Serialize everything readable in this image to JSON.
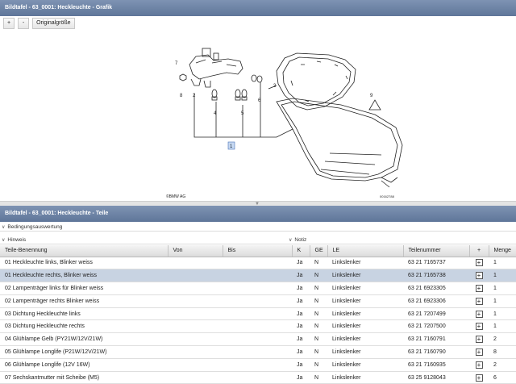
{
  "graphic_panel": {
    "title": "Bildtafel - 63_0001: Heckleuchte - Grafik"
  },
  "toolbar": {
    "zoom_in": "+",
    "zoom_out": "-",
    "original_size": "Originalgröße"
  },
  "diagram": {
    "copyright": "©BMW AG",
    "part_number_code": "00162788",
    "callouts": [
      "1",
      "2",
      "3",
      "4",
      "5",
      "6",
      "7",
      "8",
      "9"
    ]
  },
  "parts_panel": {
    "title": "Bildtafel - 63_0001: Heckleuchte - Teile"
  },
  "filters": {
    "conditions": "Bedingungsauswertung",
    "hint": "Hinweis",
    "note": "Notiz"
  },
  "table": {
    "headers": [
      "Teile-Benennung",
      "Von",
      "Bis",
      "K",
      "GE",
      "LE",
      "Teilenummer",
      "+",
      "Menge"
    ],
    "rows": [
      [
        "01 Heckleuchte links, Blinker weiss",
        "",
        "",
        "Ja",
        "N",
        "Linkslenker",
        "63 21 7165737",
        "+",
        "1"
      ],
      [
        "01 Heckleuchte rechts, Blinker weiss",
        "",
        "",
        "Ja",
        "N",
        "Linkslenker",
        "63 21 7165738",
        "+",
        "1"
      ],
      [
        "02 Lampenträger links für Blinker weiss",
        "",
        "",
        "Ja",
        "N",
        "Linkslenker",
        "63 21 6923305",
        "+",
        "1"
      ],
      [
        "02 Lampenträger rechts Blinker weiss",
        "",
        "",
        "Ja",
        "N",
        "Linkslenker",
        "63 21 6923306",
        "+",
        "1"
      ],
      [
        "03 Dichtung Heckleuchte links",
        "",
        "",
        "Ja",
        "N",
        "Linkslenker",
        "63 21 7207499",
        "+",
        "1"
      ],
      [
        "03 Dichtung Heckleuchte rechts",
        "",
        "",
        "Ja",
        "N",
        "Linkslenker",
        "63 21 7207500",
        "+",
        "1"
      ],
      [
        "04 Glühlampe Gelb (PY21W/12V/21W)",
        "",
        "",
        "Ja",
        "N",
        "Linkslenker",
        "63 21 7160791",
        "+",
        "2"
      ],
      [
        "05 Glühlampe Longlife (P21W/12V/21W)",
        "",
        "",
        "Ja",
        "N",
        "Linkslenker",
        "63 21 7160790",
        "+",
        "8"
      ],
      [
        "06 Glühlampe Longlife (12V 16W)",
        "",
        "",
        "Ja",
        "N",
        "Linkslenker",
        "63 21 7160935",
        "+",
        "2"
      ],
      [
        "07 Sechskantmutter mit Scheibe (M5)",
        "",
        "",
        "Ja",
        "N",
        "Linkslenker",
        "63 25 9128043",
        "+",
        "6"
      ]
    ],
    "selected_row": 1
  }
}
